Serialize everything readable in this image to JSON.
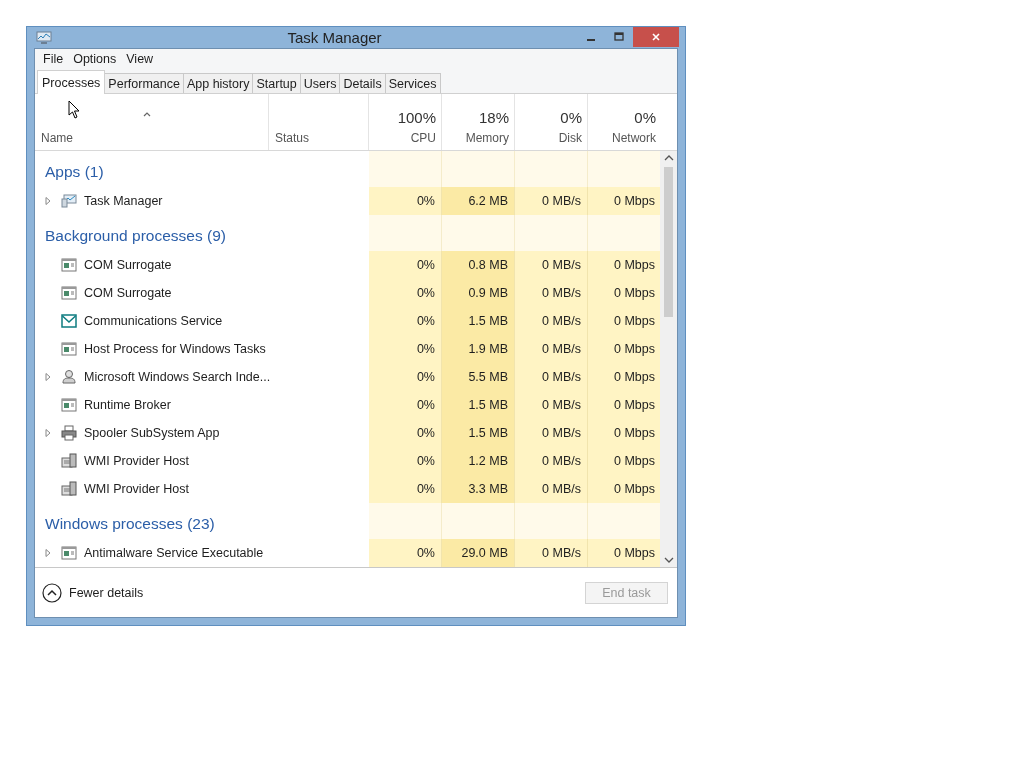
{
  "window": {
    "title": "Task Manager"
  },
  "menu": [
    "File",
    "Options",
    "View"
  ],
  "tabs": [
    {
      "label": "Processes",
      "selected": true
    },
    {
      "label": "Performance",
      "selected": false
    },
    {
      "label": "App history",
      "selected": false
    },
    {
      "label": "Startup",
      "selected": false
    },
    {
      "label": "Users",
      "selected": false
    },
    {
      "label": "Details",
      "selected": false
    },
    {
      "label": "Services",
      "selected": false
    }
  ],
  "columns": [
    {
      "label": "Name"
    },
    {
      "label": "Status"
    },
    {
      "label": "CPU",
      "reading": "100%"
    },
    {
      "label": "Memory",
      "reading": "18%"
    },
    {
      "label": "Disk",
      "reading": "0%"
    },
    {
      "label": "Network",
      "reading": "0%"
    }
  ],
  "groups": [
    {
      "title": "Apps (1)",
      "processes": [
        {
          "name": "Task Manager",
          "kind": "monitor",
          "expandable": true,
          "cpu": "0%",
          "memory": "6.2 MB",
          "disk": "0 MB/s",
          "network": "0 Mbps"
        }
      ]
    },
    {
      "title": "Background processes (9)",
      "processes": [
        {
          "name": "COM Surrogate",
          "kind": "window",
          "expandable": false,
          "cpu": "0%",
          "memory": "0.8 MB",
          "disk": "0 MB/s",
          "network": "0 Mbps"
        },
        {
          "name": "COM Surrogate",
          "kind": "window",
          "expandable": false,
          "cpu": "0%",
          "memory": "0.9 MB",
          "disk": "0 MB/s",
          "network": "0 Mbps"
        },
        {
          "name": "Communications Service",
          "kind": "mail",
          "expandable": false,
          "cpu": "0%",
          "memory": "1.5 MB",
          "disk": "0 MB/s",
          "network": "0 Mbps"
        },
        {
          "name": "Host Process for Windows Tasks",
          "kind": "window",
          "expandable": false,
          "cpu": "0%",
          "memory": "1.9 MB",
          "disk": "0 MB/s",
          "network": "0 Mbps"
        },
        {
          "name": "Microsoft Windows Search Inde...",
          "kind": "user",
          "expandable": true,
          "cpu": "0%",
          "memory": "5.5 MB",
          "disk": "0 MB/s",
          "network": "0 Mbps"
        },
        {
          "name": "Runtime Broker",
          "kind": "window",
          "expandable": false,
          "cpu": "0%",
          "memory": "1.5 MB",
          "disk": "0 MB/s",
          "network": "0 Mbps"
        },
        {
          "name": "Spooler SubSystem App",
          "kind": "printer",
          "expandable": true,
          "cpu": "0%",
          "memory": "1.5 MB",
          "disk": "0 MB/s",
          "network": "0 Mbps"
        },
        {
          "name": "WMI Provider Host",
          "kind": "server",
          "expandable": false,
          "cpu": "0%",
          "memory": "1.2 MB",
          "disk": "0 MB/s",
          "network": "0 Mbps"
        },
        {
          "name": "WMI Provider Host",
          "kind": "server",
          "expandable": false,
          "cpu": "0%",
          "memory": "3.3 MB",
          "disk": "0 MB/s",
          "network": "0 Mbps"
        }
      ]
    },
    {
      "title": "Windows processes (23)",
      "processes": [
        {
          "name": "Antimalware Service Executable",
          "kind": "window",
          "expandable": true,
          "cpu": "0%",
          "memory": "29.0 MB",
          "disk": "0 MB/s",
          "network": "0 Mbps"
        }
      ]
    }
  ],
  "footer": {
    "details_toggle": "Fewer details",
    "end_task": {
      "label": "End task",
      "disabled": true
    }
  }
}
